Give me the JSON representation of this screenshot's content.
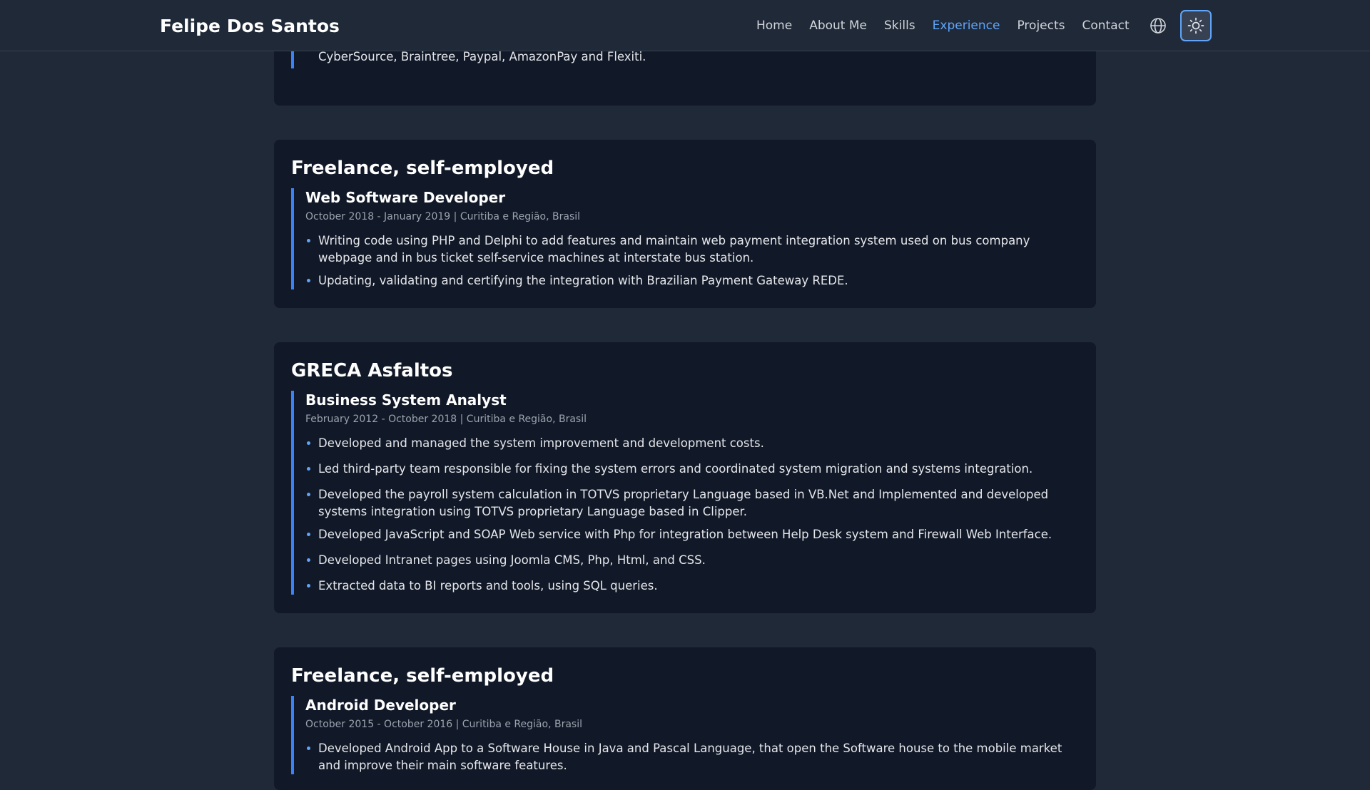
{
  "header": {
    "brand": "Felipe Dos Santos",
    "nav": [
      "Home",
      "About Me",
      "Skills",
      "Experience",
      "Projects",
      "Contact"
    ],
    "active_nav": "Experience",
    "globe_icon": "globe-icon",
    "theme_icon": "sun-icon"
  },
  "colors": {
    "accent": "#60a5fa",
    "background": "#1f2937",
    "card": "#111827"
  },
  "experience": {
    "partial_card": {
      "bullets": [
        "Implementing and maintaining multiple payment gateways integration in the Bold Checkout App, such as, Stripe, Spreedly, CyberSource, Braintree, Paypal, AmazonPay and Flexiti."
      ]
    },
    "cards": [
      {
        "company": "Freelance, self-employed",
        "role": "Web Software Developer",
        "meta": "October 2018 - January 2019 | Curitiba e Região, Brasil",
        "bullets": [
          "Writing code using PHP and Delphi to add features and maintain web payment integration system used on bus company webpage and in bus ticket self-service machines at interstate bus station.",
          "Updating, validating and certifying the integration with Brazilian Payment Gateway REDE."
        ]
      },
      {
        "company": "GRECA Asfaltos",
        "role": "Business System Analyst",
        "meta": "February 2012 - October 2018 | Curitiba e Região, Brasil",
        "bullets": [
          "Developed and managed the system improvement and development costs.",
          "Led third-party team responsible for fixing the system errors and coordinated system migration and systems integration.",
          "Developed the payroll system calculation in TOTVS proprietary Language based in VB.Net and Implemented and developed systems integration using TOTVS proprietary Language based in Clipper.",
          "Developed JavaScript and SOAP Web service with Php for integration between Help Desk system and Firewall Web Interface.",
          "Developed Intranet pages using Joomla CMS, Php, Html, and CSS.",
          "Extracted data to BI reports and tools, using SQL queries."
        ]
      },
      {
        "company": "Freelance, self-employed",
        "role": "Android Developer",
        "meta": "October 2015 - October 2016 | Curitiba e Região, Brasil",
        "bullets": [
          "Developed Android App to a Software House in Java and Pascal Language, that open the Software house to the mobile market and improve their main software features."
        ]
      }
    ]
  }
}
